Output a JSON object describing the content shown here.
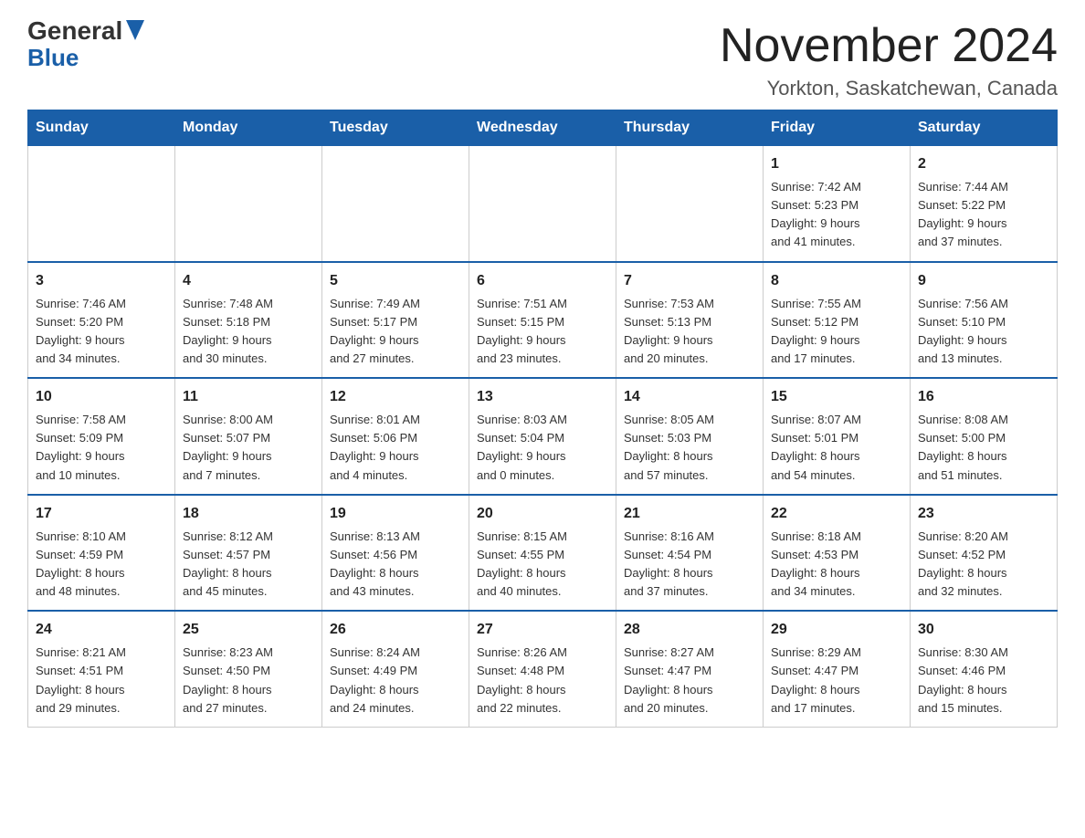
{
  "header": {
    "logo_line1": "General",
    "logo_line2": "Blue",
    "month_title": "November 2024",
    "location": "Yorkton, Saskatchewan, Canada"
  },
  "weekdays": [
    "Sunday",
    "Monday",
    "Tuesday",
    "Wednesday",
    "Thursday",
    "Friday",
    "Saturday"
  ],
  "weeks": [
    [
      {
        "day": "",
        "info": ""
      },
      {
        "day": "",
        "info": ""
      },
      {
        "day": "",
        "info": ""
      },
      {
        "day": "",
        "info": ""
      },
      {
        "day": "",
        "info": ""
      },
      {
        "day": "1",
        "info": "Sunrise: 7:42 AM\nSunset: 5:23 PM\nDaylight: 9 hours\nand 41 minutes."
      },
      {
        "day": "2",
        "info": "Sunrise: 7:44 AM\nSunset: 5:22 PM\nDaylight: 9 hours\nand 37 minutes."
      }
    ],
    [
      {
        "day": "3",
        "info": "Sunrise: 7:46 AM\nSunset: 5:20 PM\nDaylight: 9 hours\nand 34 minutes."
      },
      {
        "day": "4",
        "info": "Sunrise: 7:48 AM\nSunset: 5:18 PM\nDaylight: 9 hours\nand 30 minutes."
      },
      {
        "day": "5",
        "info": "Sunrise: 7:49 AM\nSunset: 5:17 PM\nDaylight: 9 hours\nand 27 minutes."
      },
      {
        "day": "6",
        "info": "Sunrise: 7:51 AM\nSunset: 5:15 PM\nDaylight: 9 hours\nand 23 minutes."
      },
      {
        "day": "7",
        "info": "Sunrise: 7:53 AM\nSunset: 5:13 PM\nDaylight: 9 hours\nand 20 minutes."
      },
      {
        "day": "8",
        "info": "Sunrise: 7:55 AM\nSunset: 5:12 PM\nDaylight: 9 hours\nand 17 minutes."
      },
      {
        "day": "9",
        "info": "Sunrise: 7:56 AM\nSunset: 5:10 PM\nDaylight: 9 hours\nand 13 minutes."
      }
    ],
    [
      {
        "day": "10",
        "info": "Sunrise: 7:58 AM\nSunset: 5:09 PM\nDaylight: 9 hours\nand 10 minutes."
      },
      {
        "day": "11",
        "info": "Sunrise: 8:00 AM\nSunset: 5:07 PM\nDaylight: 9 hours\nand 7 minutes."
      },
      {
        "day": "12",
        "info": "Sunrise: 8:01 AM\nSunset: 5:06 PM\nDaylight: 9 hours\nand 4 minutes."
      },
      {
        "day": "13",
        "info": "Sunrise: 8:03 AM\nSunset: 5:04 PM\nDaylight: 9 hours\nand 0 minutes."
      },
      {
        "day": "14",
        "info": "Sunrise: 8:05 AM\nSunset: 5:03 PM\nDaylight: 8 hours\nand 57 minutes."
      },
      {
        "day": "15",
        "info": "Sunrise: 8:07 AM\nSunset: 5:01 PM\nDaylight: 8 hours\nand 54 minutes."
      },
      {
        "day": "16",
        "info": "Sunrise: 8:08 AM\nSunset: 5:00 PM\nDaylight: 8 hours\nand 51 minutes."
      }
    ],
    [
      {
        "day": "17",
        "info": "Sunrise: 8:10 AM\nSunset: 4:59 PM\nDaylight: 8 hours\nand 48 minutes."
      },
      {
        "day": "18",
        "info": "Sunrise: 8:12 AM\nSunset: 4:57 PM\nDaylight: 8 hours\nand 45 minutes."
      },
      {
        "day": "19",
        "info": "Sunrise: 8:13 AM\nSunset: 4:56 PM\nDaylight: 8 hours\nand 43 minutes."
      },
      {
        "day": "20",
        "info": "Sunrise: 8:15 AM\nSunset: 4:55 PM\nDaylight: 8 hours\nand 40 minutes."
      },
      {
        "day": "21",
        "info": "Sunrise: 8:16 AM\nSunset: 4:54 PM\nDaylight: 8 hours\nand 37 minutes."
      },
      {
        "day": "22",
        "info": "Sunrise: 8:18 AM\nSunset: 4:53 PM\nDaylight: 8 hours\nand 34 minutes."
      },
      {
        "day": "23",
        "info": "Sunrise: 8:20 AM\nSunset: 4:52 PM\nDaylight: 8 hours\nand 32 minutes."
      }
    ],
    [
      {
        "day": "24",
        "info": "Sunrise: 8:21 AM\nSunset: 4:51 PM\nDaylight: 8 hours\nand 29 minutes."
      },
      {
        "day": "25",
        "info": "Sunrise: 8:23 AM\nSunset: 4:50 PM\nDaylight: 8 hours\nand 27 minutes."
      },
      {
        "day": "26",
        "info": "Sunrise: 8:24 AM\nSunset: 4:49 PM\nDaylight: 8 hours\nand 24 minutes."
      },
      {
        "day": "27",
        "info": "Sunrise: 8:26 AM\nSunset: 4:48 PM\nDaylight: 8 hours\nand 22 minutes."
      },
      {
        "day": "28",
        "info": "Sunrise: 8:27 AM\nSunset: 4:47 PM\nDaylight: 8 hours\nand 20 minutes."
      },
      {
        "day": "29",
        "info": "Sunrise: 8:29 AM\nSunset: 4:47 PM\nDaylight: 8 hours\nand 17 minutes."
      },
      {
        "day": "30",
        "info": "Sunrise: 8:30 AM\nSunset: 4:46 PM\nDaylight: 8 hours\nand 15 minutes."
      }
    ]
  ]
}
